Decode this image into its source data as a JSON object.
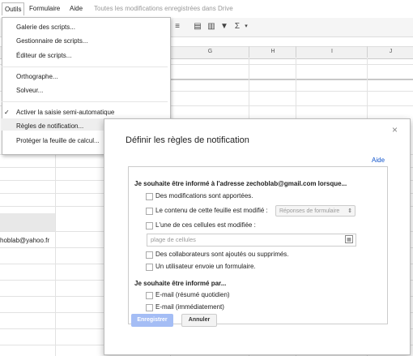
{
  "menubar": {
    "items": [
      "Outils",
      "Formulaire",
      "Aide"
    ],
    "save_status": "Toutes les modifications enregistrées dans Drive"
  },
  "sheet": {
    "columns": [
      "G",
      "H",
      "I",
      "J"
    ],
    "cell_email": "hoblab@yahoo.fr"
  },
  "tools_menu": {
    "items": [
      "Galerie des scripts...",
      "Gestionnaire de scripts...",
      "Éditeur de scripts...",
      "Orthographe...",
      "Solveur...",
      "Activer la saisie semi-automatique",
      "Règles de notification...",
      "Protéger la feuille de calcul..."
    ],
    "check_mark": "✓"
  },
  "dialog": {
    "title": "Définir les règles de notification",
    "close": "×",
    "help": "Aide",
    "section1_heading": "Je souhaite être informé à l'adresse zechoblab@gmail.com lorsque...",
    "option_modifications": "Des modifications sont apportées.",
    "option_sheet_content": "Le contenu de cette feuille est modifié :",
    "sheet_select_value": "Réponses de formulaire",
    "option_cells": "L'une de ces cellules est modifiée :",
    "range_placeholder": "plage de cellules",
    "option_collaborators": "Des collaborateurs sont ajoutés ou supprimés.",
    "option_form": "Un utilisateur envoie un formulaire.",
    "section2_heading": "Je souhaite être informé par...",
    "option_daily": "E-mail (résumé quotidien)",
    "option_immediate": "E-mail (immédiatement)",
    "save_button": "Enregistrer",
    "cancel_button": "Annuler"
  }
}
